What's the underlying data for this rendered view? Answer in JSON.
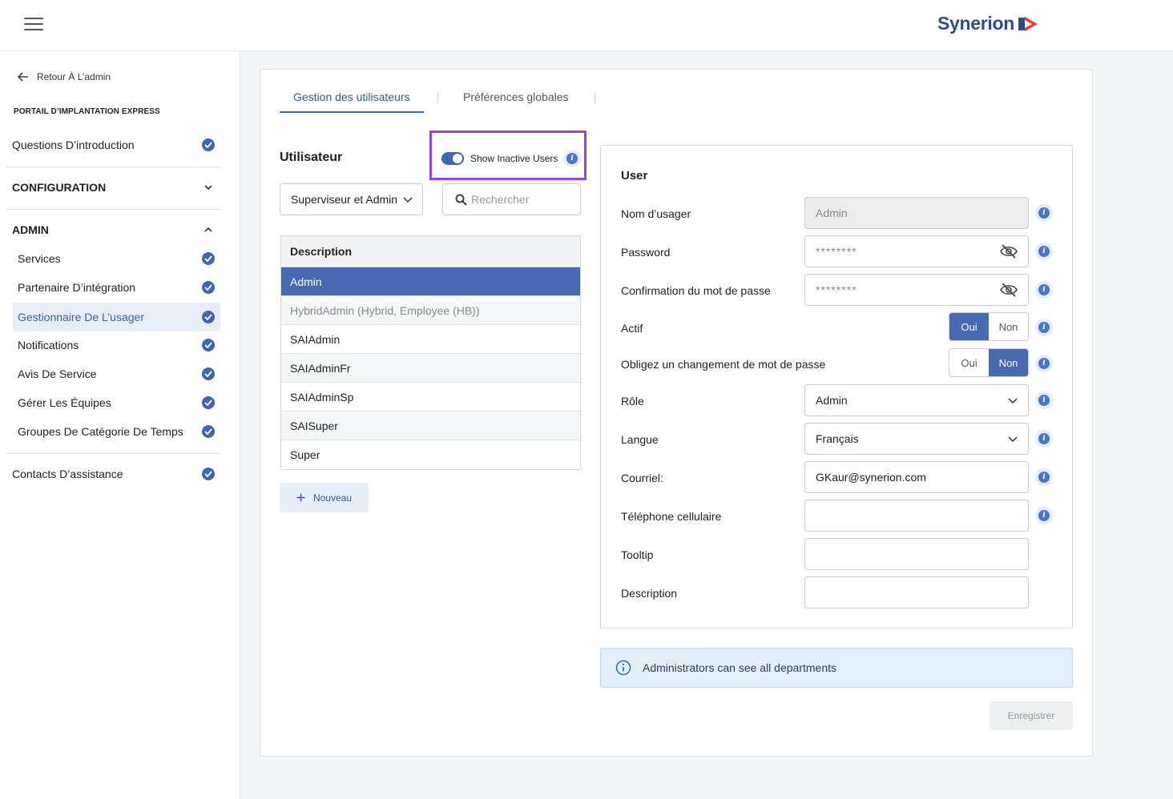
{
  "header": {
    "brand": "Synerion"
  },
  "sidebar": {
    "back_label": "Retour À L’admin",
    "portal_title": "PORTAIL D’IMPLANTATION EXPRESS",
    "intro": "Questions D’introduction",
    "configuration": "CONFIGURATION",
    "admin": "ADMIN",
    "admin_items": [
      "Services",
      "Partenaire D’intégration",
      "Gestionnaire De L’usager",
      "Notifications",
      "Avis De Service",
      "Gérer Les Équipes",
      "Groupes De Catégorie De Temps"
    ],
    "support": "Contacts D’assistance"
  },
  "tabs": [
    "Gestion des utilisateurs",
    "Préférences globales"
  ],
  "users": {
    "title": "Utilisateur",
    "show_inactive_label": "Show Inactive Users",
    "filter_value": "Superviseur et Admin",
    "search_placeholder": "Rechercher",
    "column_header": "Description",
    "rows": [
      "Admin",
      "HybridAdmin (Hybrid, Employee (HB))",
      "SAIAdmin",
      "SAIAdminFr",
      "SAIAdminSp",
      "SAISuper",
      "Super"
    ],
    "new_label": "Nouveau"
  },
  "user_form": {
    "title": "User",
    "username_label": "Nom d’usager",
    "username_value": "Admin",
    "password_label": "Password",
    "password_value": "********",
    "confirm_label": "Confirmation du mot de passe",
    "confirm_value": "********",
    "active_label": "Actif",
    "force_change_label": "Obligez un changement de mot de passe",
    "yes": "Oui",
    "no": "Non",
    "role_label": "Rôle",
    "role_value": "Admin",
    "language_label": "Langue",
    "language_value": "Français",
    "email_label": "Courriel:",
    "email_value": "GKaur@synerion.com",
    "cell_label": "Téléphone cellulaire",
    "cell_value": "",
    "tooltip_label": "Tooltip",
    "tooltip_value": "",
    "description_label": "Description",
    "description_value": ""
  },
  "banner": {
    "text": "Administrators can see all departments"
  },
  "save_label": "Enregistrer",
  "colors": {
    "accent": "#4769b0",
    "highlight_box": "#a23fe0",
    "brand": "#2b4d8e"
  }
}
